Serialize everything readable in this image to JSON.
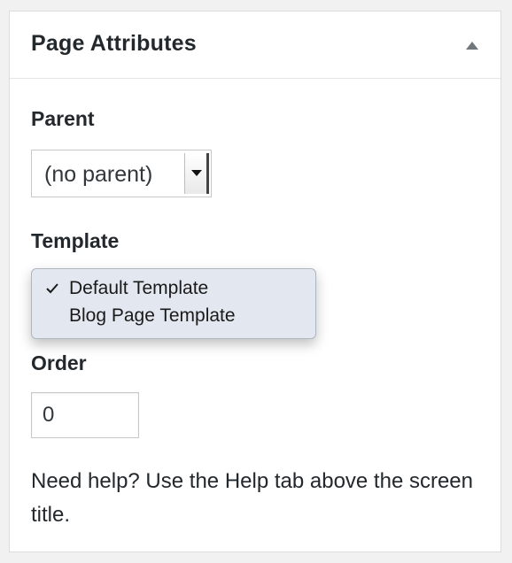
{
  "panel": {
    "title": "Page Attributes",
    "toggle_icon": "triangle-up-icon"
  },
  "parent": {
    "label": "Parent",
    "selected": "(no parent)"
  },
  "template": {
    "label": "Template",
    "options": [
      {
        "label": "Default Template",
        "selected": true
      },
      {
        "label": "Blog Page Template",
        "selected": false
      }
    ]
  },
  "order": {
    "label": "Order",
    "value": "0"
  },
  "help": {
    "text": "Need help? Use the Help tab above the screen title."
  },
  "colors": {
    "panel_bg": "#ffffff",
    "page_bg": "#f1f1f1",
    "text": "#23282d",
    "dropdown_bg": "#e3e8f0"
  }
}
